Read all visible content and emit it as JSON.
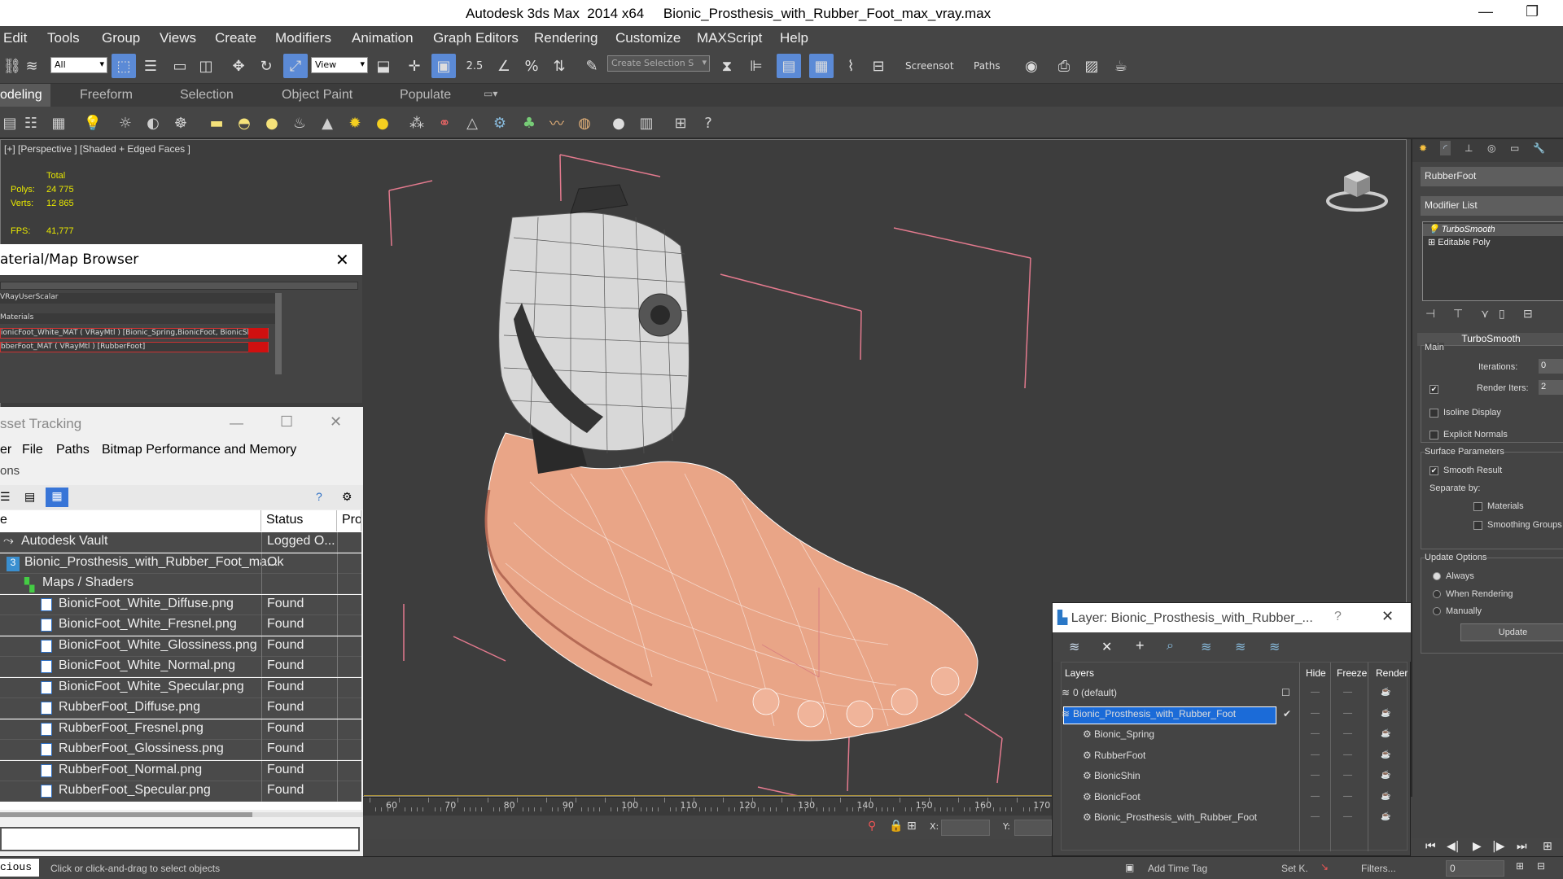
{
  "window": {
    "title": "Autodesk 3ds Max  2014 x64     Bionic_Prosthesis_with_Rubber_Foot_max_vray.max",
    "minimize_icon": "minimize-icon",
    "restore_icon": "restore-icon"
  },
  "menu": [
    "Edit",
    "Tools",
    "Group",
    "Views",
    "Create",
    "Modifiers",
    "Animation",
    "Graph Editors",
    "Rendering",
    "Customize",
    "MAXScript",
    "Help"
  ],
  "toolbar": {
    "filter_value": "All",
    "refcoord_value": "View",
    "spinner_snap_label": "2.5",
    "named_selection_placeholder": "Create Selection S",
    "screenshot_label": "Screensot",
    "paths_label": "Paths"
  },
  "ribbon": {
    "tabs": [
      "odeling",
      "Freeform",
      "Selection",
      "Object Paint",
      "Populate"
    ]
  },
  "viewport": {
    "label": "[+] [Perspective ] [Shaded + Edged Faces ]",
    "stats_header": "Total",
    "polys_label": "Polys:",
    "polys_value": "24 775",
    "verts_label": "Verts:",
    "verts_value": "12 865",
    "fps_label": "FPS:",
    "fps_value": "41,777"
  },
  "material_browser": {
    "title": "aterial/Map Browser",
    "rows": [
      "VRayUserScalar",
      "Materials",
      "ionicFoot_White_MAT ( VRayMtl ) [Bionic_Spring,BionicFoot, BionicShin]",
      "bberFoot_MAT ( VRayMtl ) [RubberFoot]"
    ]
  },
  "asset_tracking": {
    "title": "sset Tracking",
    "menu": [
      "er",
      "File",
      "Paths",
      "Bitmap Performance and Memory"
    ],
    "submenu": "ons",
    "columns": [
      "e",
      "Status",
      "Pro"
    ],
    "rows": [
      {
        "name": "Autodesk Vault",
        "status": "Logged O...",
        "indent": 0
      },
      {
        "name": "Bionic_Prosthesis_with_Rubber_Foot_ma...",
        "status": "Ok",
        "indent": 1
      },
      {
        "name": "Maps / Shaders",
        "status": "",
        "indent": 2
      },
      {
        "name": "BionicFoot_White_Diffuse.png",
        "status": "Found",
        "indent": 3
      },
      {
        "name": "BionicFoot_White_Fresnel.png",
        "status": "Found",
        "indent": 3
      },
      {
        "name": "BionicFoot_White_Glossiness.png",
        "status": "Found",
        "indent": 3
      },
      {
        "name": "BionicFoot_White_Normal.png",
        "status": "Found",
        "indent": 3
      },
      {
        "name": "BionicFoot_White_Specular.png",
        "status": "Found",
        "indent": 3
      },
      {
        "name": "RubberFoot_Diffuse.png",
        "status": "Found",
        "indent": 3
      },
      {
        "name": "RubberFoot_Fresnel.png",
        "status": "Found",
        "indent": 3
      },
      {
        "name": "RubberFoot_Glossiness.png",
        "status": "Found",
        "indent": 3
      },
      {
        "name": "RubberFoot_Normal.png",
        "status": "Found",
        "indent": 3
      },
      {
        "name": "RubberFoot_Specular.png",
        "status": "Found",
        "indent": 3
      }
    ]
  },
  "layer_panel": {
    "title": "Layer: Bionic_Prosthesis_with_Rubber_...",
    "help": "?",
    "columns": [
      "Layers",
      "Hide",
      "Freeze",
      "Render"
    ],
    "rows": [
      {
        "name": "0 (default)",
        "selected": false,
        "indent": 0
      },
      {
        "name": "Bionic_Prosthesis_with_Rubber_Foot",
        "selected": true,
        "indent": 0
      },
      {
        "name": "Bionic_Spring",
        "selected": false,
        "indent": 1
      },
      {
        "name": "RubberFoot",
        "selected": false,
        "indent": 1
      },
      {
        "name": "BionicShin",
        "selected": false,
        "indent": 1
      },
      {
        "name": "BionicFoot",
        "selected": false,
        "indent": 1
      },
      {
        "name": "Bionic_Prosthesis_with_Rubber_Foot",
        "selected": false,
        "indent": 1
      }
    ]
  },
  "command_panel": {
    "object_name": "RubberFoot",
    "modifier_list": "Modifier List",
    "stack": [
      "TurboSmooth",
      "Editable Poly"
    ],
    "rollout_title": "TurboSmooth",
    "main_label": "Main",
    "iterations_label": "Iterations:",
    "iterations_value": "0",
    "render_iters_label": "Render Iters:",
    "render_iters_value": "2",
    "isoline_label": "Isoline Display",
    "explicit_normals_label": "Explicit Normals",
    "surface_params_label": "Surface Parameters",
    "smooth_result_label": "Smooth Result",
    "separate_by_label": "Separate by:",
    "materials_label": "Materials",
    "smoothing_groups_label": "Smoothing Groups",
    "update_options_label": "Update Options",
    "always_label": "Always",
    "when_rendering_label": "When Rendering",
    "manually_label": "Manually",
    "update_button": "Update"
  },
  "timeline": {
    "ticks": [
      "60",
      "70",
      "80",
      "90",
      "100",
      "110",
      "120",
      "130",
      "140",
      "150",
      "160",
      "170"
    ],
    "x_label": "X:",
    "y_label": "Y:"
  },
  "status": {
    "maxscript_text": "cious",
    "prompt": "Click or click-and-drag to select objects",
    "add_time_tag": "Add Time Tag",
    "set_key": "Set K.",
    "filters": "Filters...",
    "frame_value": "0"
  }
}
